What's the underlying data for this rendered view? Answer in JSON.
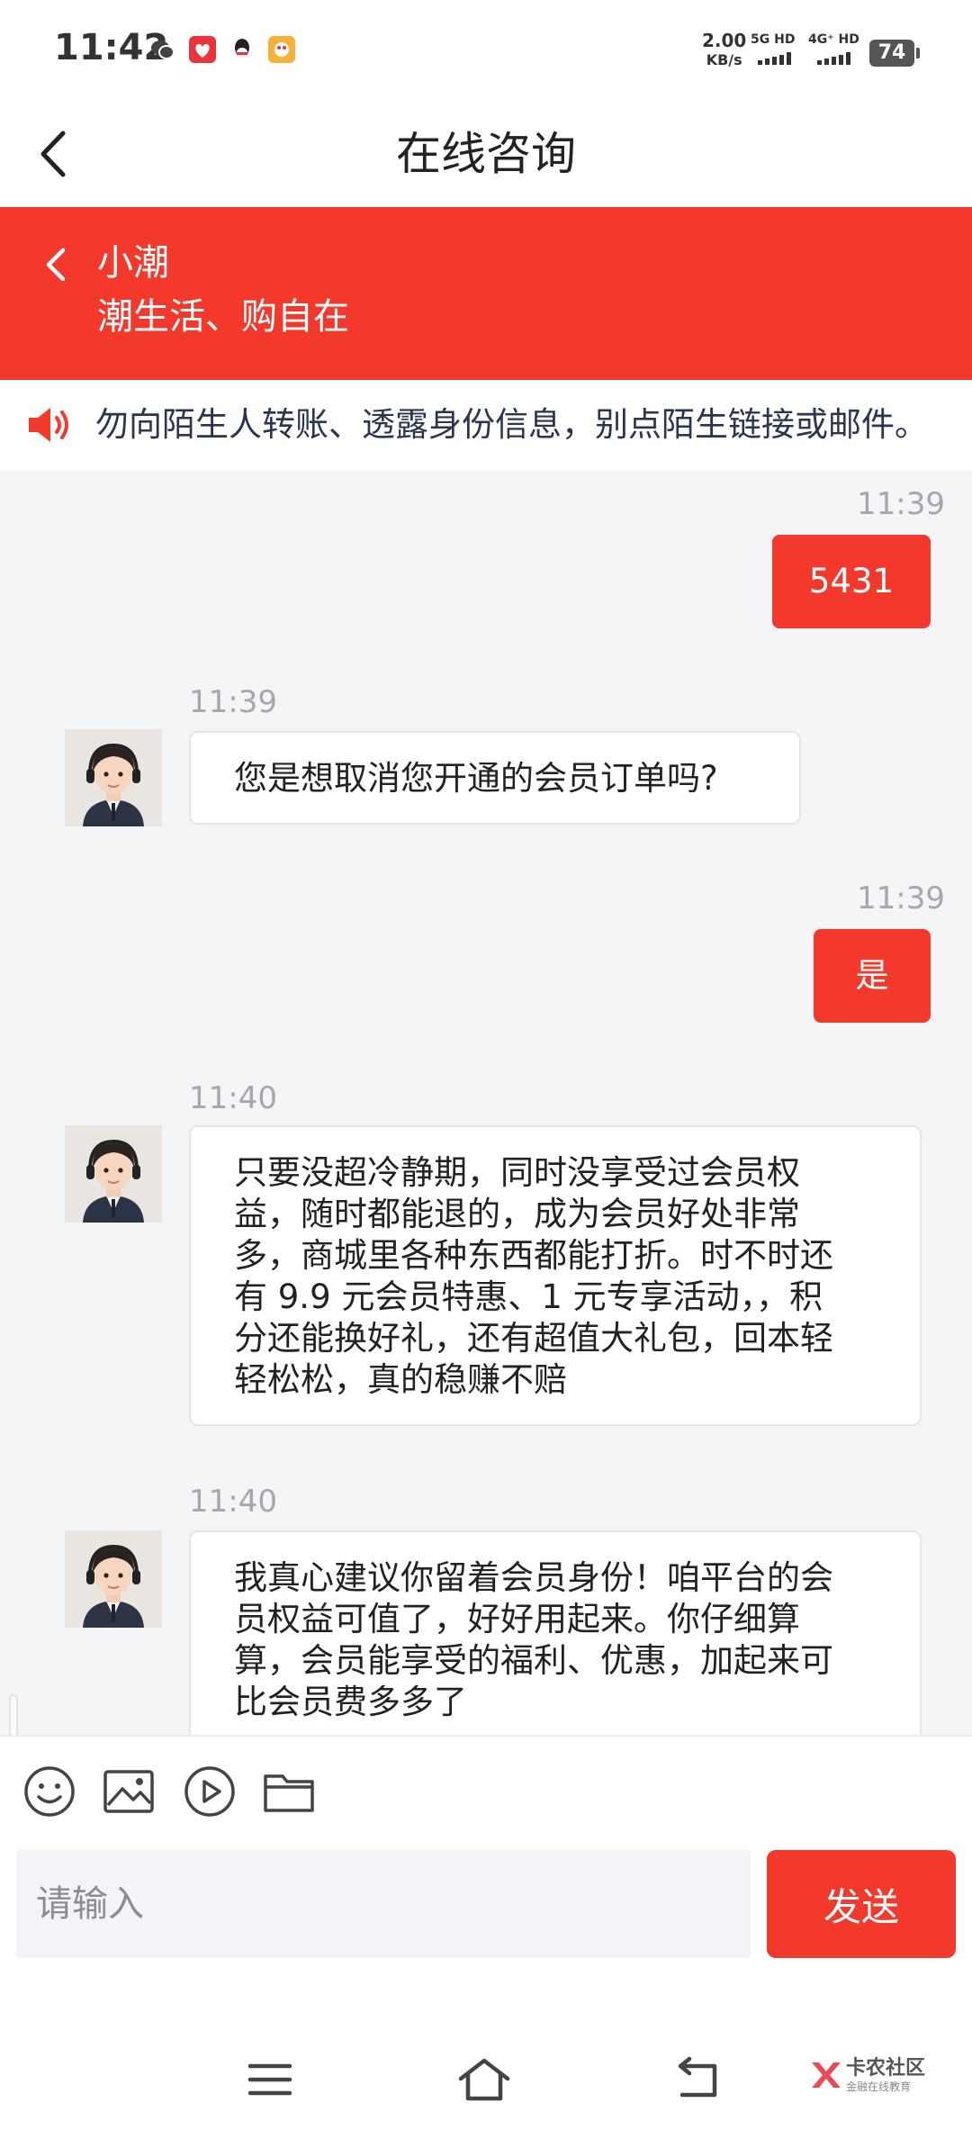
{
  "status_bar": {
    "time": "11:42",
    "speed_value": "2.00",
    "speed_unit": "KB/s",
    "net1": "5G HD",
    "net2": "4G⁺ HD",
    "battery": "74"
  },
  "title_bar": {
    "title": "在线咨询"
  },
  "agent": {
    "name": "小潮",
    "slogan": "潮生活、购自在"
  },
  "notice": {
    "text": "勿向陌生人转账、透露身份信息，别点陌生链接或邮件。"
  },
  "messages": [
    {
      "direction": "out",
      "time": "11:39",
      "text": "5431"
    },
    {
      "direction": "in",
      "time": "11:39",
      "lines": [
        "您是想取消您开通的会员订单吗?"
      ]
    },
    {
      "direction": "out",
      "time": "11:39",
      "text": "是"
    },
    {
      "direction": "in",
      "time": "11:40",
      "lines": [
        "只要没超冷静期，同时没享受过会员权",
        "益，随时都能退的，成为会员好处非常",
        "多，商城里各种东西都能打折。时不时还",
        "有 9.9 元会员特惠、1 元专享活动，，积",
        "分还能换好礼，还有超值大礼包，回本轻",
        "轻松松，真的稳赚不赔"
      ]
    },
    {
      "direction": "in",
      "time": "11:40",
      "lines": [
        "我真心建议你留着会员身份！咱平台的会",
        "员权益可值了，好好用起来。你仔细算",
        "算，会员能享受的福利、优惠，加起来可",
        "比会员费多多了"
      ]
    }
  ],
  "toolbar": {
    "icons": [
      "emoji-icon",
      "image-icon",
      "video-icon",
      "folder-icon"
    ]
  },
  "input": {
    "placeholder": "请输入",
    "value": ""
  },
  "send_label": "发送",
  "watermark": {
    "title": "卡农社区",
    "subtitle": "金融在线教育"
  },
  "colors": {
    "accent": "#f2392c",
    "chat_bg": "#f5f5f7",
    "timestamp": "#a4a7ad"
  }
}
